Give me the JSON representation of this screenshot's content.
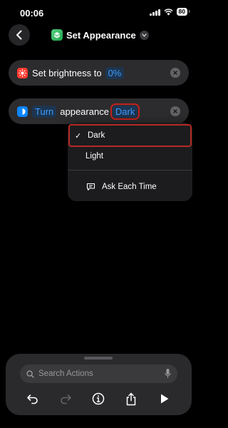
{
  "status_bar": {
    "time": "00:06",
    "battery": "80"
  },
  "nav": {
    "title": "Set Appearance"
  },
  "actions": [
    {
      "text": "Set brightness to",
      "value": "0%"
    },
    {
      "verb": "Turn",
      "text": "appearance",
      "value": "Dark"
    }
  ],
  "menu": {
    "items": [
      {
        "label": "Dark",
        "selected": true
      },
      {
        "label": "Light",
        "selected": false
      }
    ],
    "ask_each_time": "Ask Each Time"
  },
  "search": {
    "placeholder": "Search Actions"
  },
  "colors": {
    "accent": "#3d9bff",
    "highlight_box": "#c4221e",
    "brightness_icon": "#ff3b30",
    "appearance_icon": "#0a84ff"
  },
  "icons": [
    "back-chevron-icon",
    "shortcuts-app-icon",
    "brightness-icon",
    "appearance-icon",
    "checkmark-icon",
    "ask-each-time-icon",
    "search-icon",
    "microphone-icon",
    "undo-icon",
    "redo-icon",
    "info-icon",
    "share-icon",
    "play-icon"
  ]
}
